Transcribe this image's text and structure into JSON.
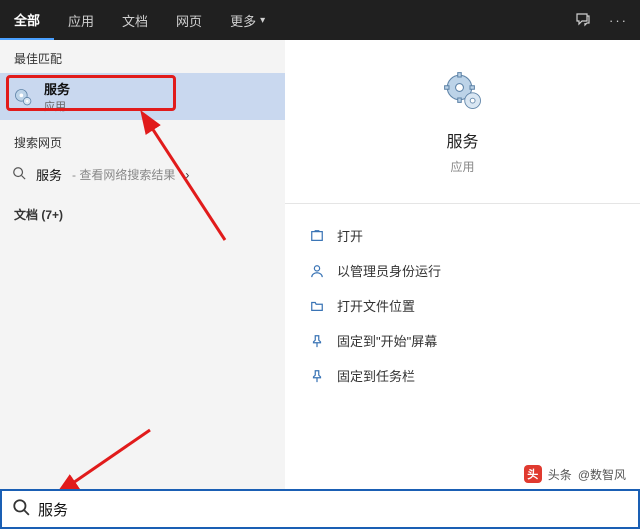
{
  "tabs": {
    "all": "全部",
    "apps": "应用",
    "docs": "文档",
    "web": "网页",
    "more": "更多"
  },
  "left": {
    "best_match_header": "最佳匹配",
    "best_match": {
      "title": "服务",
      "subtitle": "应用"
    },
    "search_web_header": "搜索网页",
    "web_result": {
      "term": "服务",
      "hint": "- 查看网络搜索结果"
    },
    "docs_header": "文档 (7+)"
  },
  "detail": {
    "title": "服务",
    "subtitle": "应用"
  },
  "actions": {
    "open": "打开",
    "run_admin": "以管理员身份运行",
    "open_location": "打开文件位置",
    "pin_start": "固定到\"开始\"屏幕",
    "pin_taskbar": "固定到任务栏"
  },
  "search": {
    "value": "服务"
  },
  "watermark": {
    "label": "头条",
    "handle": "@数智风"
  }
}
